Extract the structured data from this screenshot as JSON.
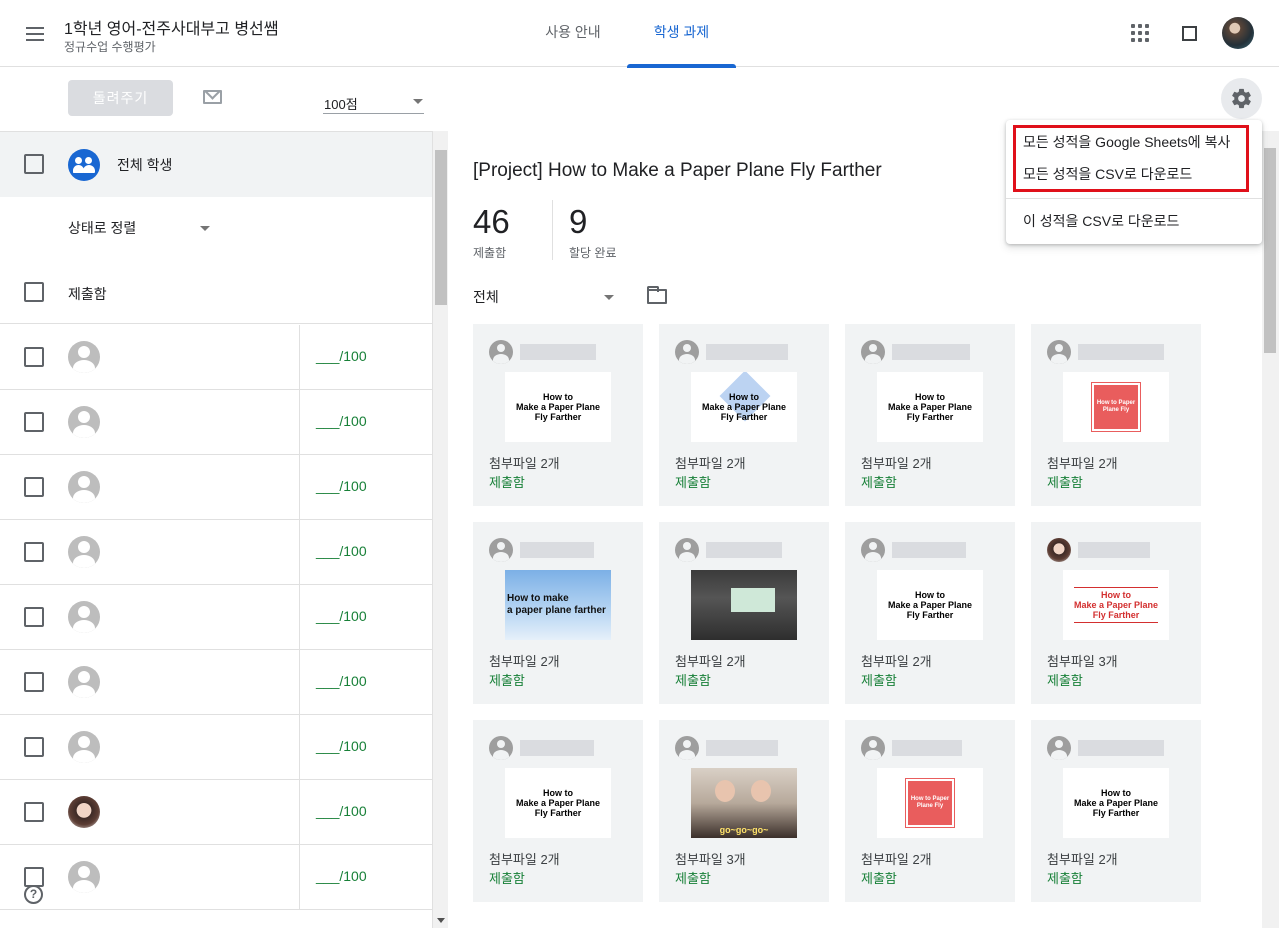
{
  "header": {
    "class_title": "1학년 영어-전주사대부고 병선쌤",
    "class_subtitle": "정규수업 수행평가",
    "tabs": [
      {
        "label": "사용 안내"
      },
      {
        "label": "학생 과제"
      }
    ],
    "active_tab": "학생 과제"
  },
  "toolbar": {
    "return_button": "돌려주기",
    "points_value": "100점"
  },
  "left": {
    "all_students": "전체 학생",
    "sort_label": "상태로 정렬",
    "section_label": "제출함",
    "students": [
      {
        "grade": "___/100",
        "avatar": "default"
      },
      {
        "grade": "___/100",
        "avatar": "default"
      },
      {
        "grade": "___/100",
        "avatar": "default"
      },
      {
        "grade": "___/100",
        "avatar": "default"
      },
      {
        "grade": "___/100",
        "avatar": "default"
      },
      {
        "grade": "___/100",
        "avatar": "default"
      },
      {
        "grade": "___/100",
        "avatar": "default"
      },
      {
        "grade": "___/100",
        "avatar": "photo"
      },
      {
        "grade": "___/100",
        "avatar": "default"
      }
    ],
    "help_symbol": "?"
  },
  "main": {
    "assignment_title": "[Project] How to Make a Paper Plane Fly Farther",
    "stats": [
      {
        "value": "46",
        "label": "제출함"
      },
      {
        "value": "9",
        "label": "할당 완료"
      }
    ],
    "filter_label": "전체",
    "cards": [
      {
        "thumb": "How to\nMake a Paper Plane\nFly Farther",
        "style": "white",
        "attachments": "첨부파일 2개",
        "status": "제출함"
      },
      {
        "thumb": "How to\nMake a Paper Plane\nFly Farther",
        "style": "plane",
        "attachments": "첨부파일 2개",
        "status": "제출함"
      },
      {
        "thumb": "How to\nMake a Paper Plane\nFly Farther",
        "style": "white",
        "attachments": "첨부파일 2개",
        "status": "제출함"
      },
      {
        "thumb": "How to\nPaper Plane Fly",
        "style": "red-sq",
        "attachments": "첨부파일 2개",
        "status": "제출함"
      },
      {
        "thumb": "How to make\na paper plane farther",
        "style": "sky",
        "attachments": "첨부파일 2개",
        "status": "제출함"
      },
      {
        "thumb": "",
        "style": "classroom",
        "attachments": "첨부파일 2개",
        "status": "제출함"
      },
      {
        "thumb": "How to\nMake a Paper Plane\nFly Farther",
        "style": "white",
        "attachments": "첨부파일 2개",
        "status": "제출함"
      },
      {
        "thumb": "How to\nMake a Paper Plane\nFly Farther",
        "style": "redlines",
        "attachments": "첨부파일 3개",
        "status": "제출함"
      },
      {
        "thumb": "How to\nMake a Paper Plane\nFly Farther",
        "style": "white",
        "attachments": "첨부파일 2개",
        "status": "제출함"
      },
      {
        "thumb": "go~go~go~",
        "style": "girls",
        "attachments": "첨부파일 3개",
        "status": "제출함"
      },
      {
        "thumb": "How to\nPaper Plane Fly",
        "style": "red-sq",
        "attachments": "첨부파일 2개",
        "status": "제출함"
      },
      {
        "thumb": "How to\nMake a Paper Plane\nFly Farther",
        "style": "white",
        "attachments": "첨부파일 2개",
        "status": "제출함"
      }
    ]
  },
  "gear_menu": {
    "items": [
      {
        "label": "모든 성적을 Google Sheets에 복사"
      },
      {
        "label": "모든 성적을 CSV로 다운로드"
      },
      {
        "label": "이 성적을 CSV로 다운로드"
      }
    ],
    "highlight_color": "#e0101a"
  },
  "colors": {
    "accent": "#1967d2",
    "submitted_green": "#188038"
  }
}
